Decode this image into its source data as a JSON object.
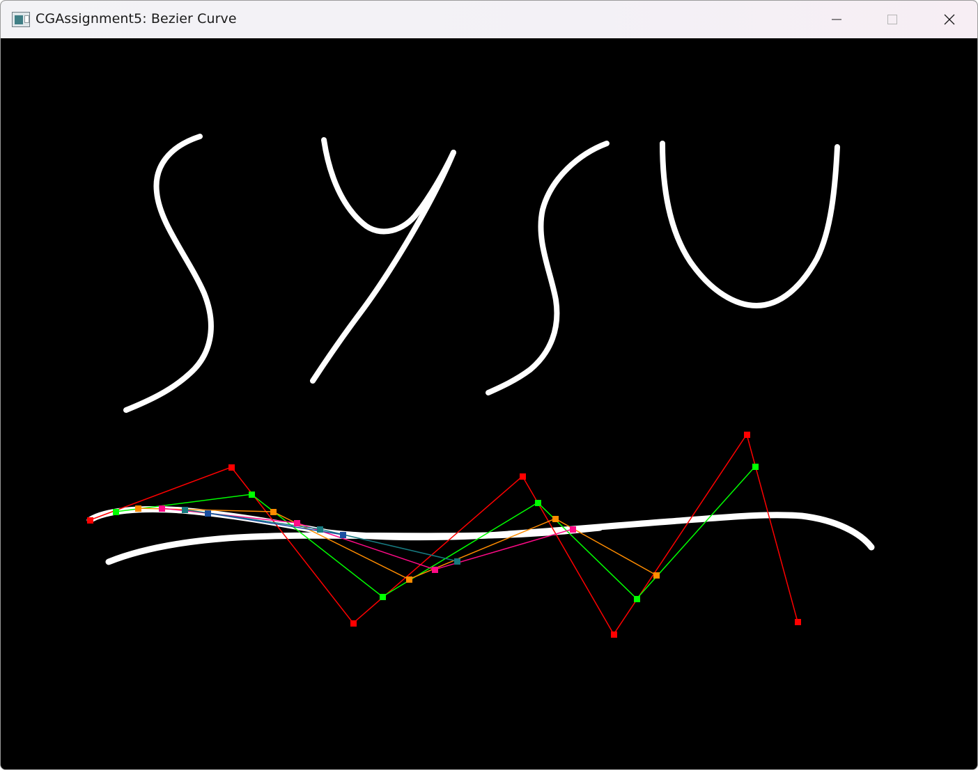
{
  "window": {
    "title": "CGAssignment5: Bezier Curve",
    "icon": "app-window-icon",
    "controls": [
      "minimize-icon",
      "maximize-icon",
      "close-icon"
    ]
  },
  "canvas": {
    "background": "#000000",
    "handwriting_color": "#ffffff",
    "handwritten_letters": [
      "S",
      "Y",
      "S",
      "U"
    ],
    "level_colors": [
      "#ff0000",
      "#00ff00",
      "#ff8c00",
      "#ff0a87",
      "#177a80"
    ],
    "curve_color": "#ffffff"
  }
}
